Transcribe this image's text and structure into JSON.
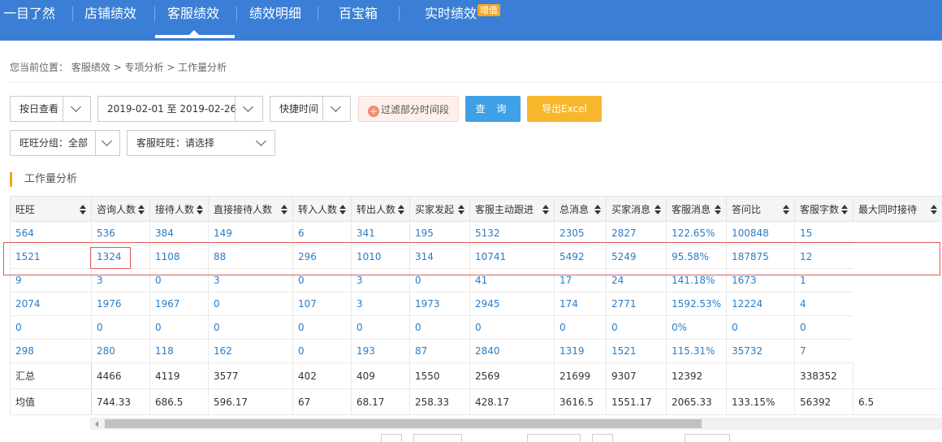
{
  "nav": {
    "items": [
      {
        "label": "一目了然"
      },
      {
        "label": "店铺绩效"
      },
      {
        "label": "客服绩效"
      },
      {
        "label": "绩效明细"
      },
      {
        "label": "百宝箱"
      },
      {
        "label": "实时绩效",
        "badge": "增值"
      }
    ],
    "active_index": 2,
    "colors": {
      "bar": "#3a7fd5",
      "badge": "#f5a623"
    }
  },
  "breadcrumb": "您当前位置： 客服绩效 > 专项分析 > 工作量分析",
  "filters": {
    "view_mode": "按日查看",
    "date_range": "2019-02-01 至 2019-02-26",
    "quick_time": "快捷时间",
    "filter_button": "过滤部分时间段",
    "query_button": "查 询",
    "export_button": "导出Excel",
    "group": "旺旺分组：全部",
    "agent": "客服旺旺：请选择"
  },
  "section_title": "工作量分析",
  "table": {
    "columns": [
      "旺旺",
      "咨询人数",
      "接待人数",
      "直接接待人数",
      "转入人数",
      "转出人数",
      "买家发起",
      "客服主动跟进",
      "总消息",
      "买家消息",
      "客服消息",
      "答问比",
      "客服字数",
      "最大同时接待"
    ],
    "rows": [
      [
        "",
        "564",
        "536",
        "384",
        "149",
        "6",
        "341",
        "195",
        "5132",
        "2305",
        "2827",
        "122.65%",
        "100848",
        "15"
      ],
      [
        "",
        "1521",
        "1324",
        "1108",
        "88",
        "296",
        "1010",
        "314",
        "10741",
        "5492",
        "5249",
        "95.58%",
        "187875",
        "12"
      ],
      [
        "",
        "9",
        "3",
        "0",
        "3",
        "0",
        "3",
        "0",
        "41",
        "17",
        "24",
        "141.18%",
        "1673",
        "1"
      ],
      [
        "",
        "2074",
        "1976",
        "1967",
        "0",
        "107",
        "3",
        "1973",
        "2945",
        "174",
        "2771",
        "1592.53%",
        "12224",
        "4"
      ],
      [
        "",
        "0",
        "0",
        "0",
        "0",
        "0",
        "0",
        "0",
        "0",
        "0",
        "0",
        "0%",
        "0",
        "0"
      ],
      [
        "",
        "298",
        "280",
        "118",
        "162",
        "0",
        "193",
        "87",
        "2840",
        "1319",
        "1521",
        "115.31%",
        "35732",
        "7"
      ]
    ],
    "summary": [
      "汇总",
      "4466",
      "4119",
      "3577",
      "402",
      "409",
      "1550",
      "2569",
      "21699",
      "9307",
      "12392",
      "",
      "338352",
      ""
    ],
    "average": [
      "均值",
      "744.33",
      "686.5",
      "596.17",
      "67",
      "68.17",
      "258.33",
      "428.17",
      "3616.5",
      "1551.17",
      "2065.33",
      "133.15%",
      "56392",
      "6.5"
    ],
    "value_color": "#2a7cc7",
    "highlight_color": "#e05a5a"
  }
}
